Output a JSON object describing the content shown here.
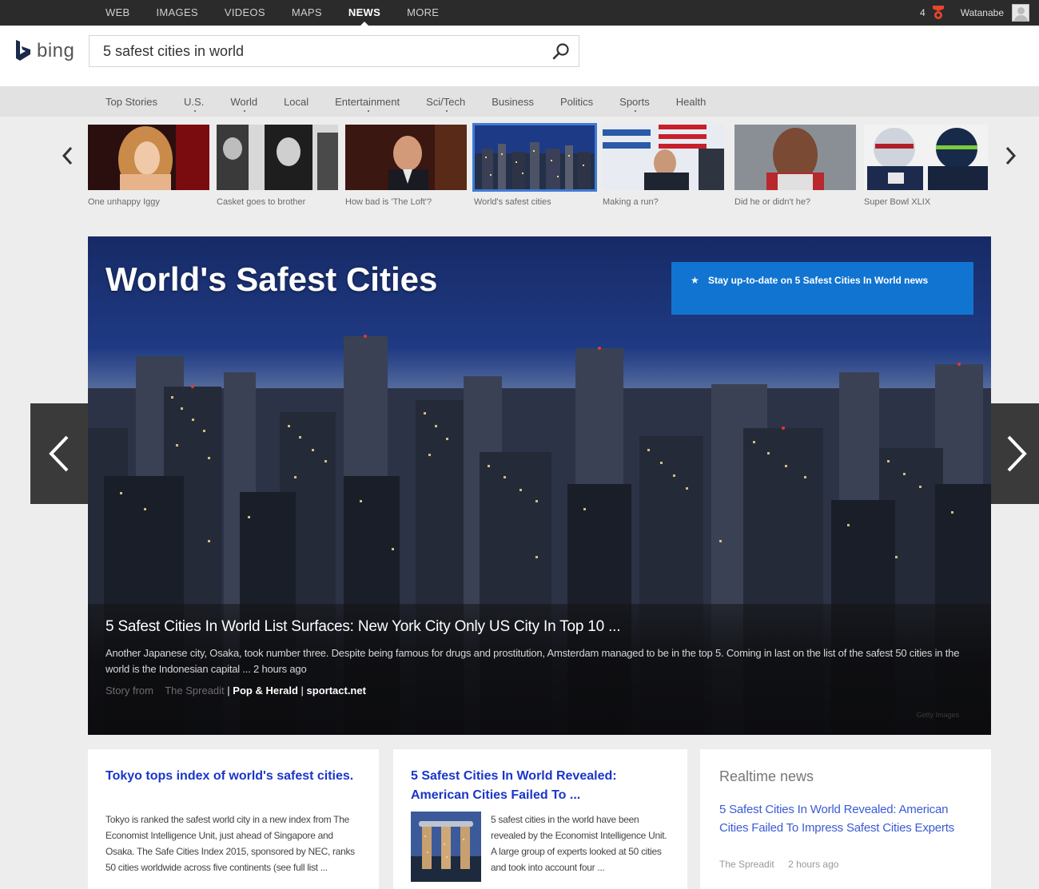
{
  "topnav": {
    "items": [
      {
        "label": "WEB"
      },
      {
        "label": "IMAGES"
      },
      {
        "label": "VIDEOS"
      },
      {
        "label": "MAPS"
      },
      {
        "label": "NEWS",
        "active": true
      },
      {
        "label": "MORE"
      }
    ],
    "reward_count": "4",
    "username": "Watanabe"
  },
  "header": {
    "logo_text": "bing",
    "search_value": "5 safest cities in world"
  },
  "categories": [
    "Top Stories",
    "U.S.",
    "World",
    "Local",
    "Entertainment",
    "Sci/Tech",
    "Business",
    "Politics",
    "Sports",
    "Health"
  ],
  "thumbs": [
    {
      "caption": "One unhappy Iggy"
    },
    {
      "caption": "Casket goes to brother"
    },
    {
      "caption": "How bad is 'The Loft'?"
    },
    {
      "caption": "World's safest cities",
      "active": true
    },
    {
      "caption": "Making a run?"
    },
    {
      "caption": "Did he or didn't he?"
    },
    {
      "caption": "Super Bowl XLIX"
    }
  ],
  "hero": {
    "title": "World's Safest Cities",
    "follow_label": "Stay up-to-date on 5 Safest Cities In World news",
    "headline": "5 Safest Cities In World List Surfaces: New York City Only US City In Top 10 ...",
    "snippet": "Another Japanese city, Osaka, took number three. Despite being famous for drugs and prostitution, Amsterdam managed to be in the top 5. Coming in last on the list of the safest 50 cities in the world is the Indonesian capital ... 2 hours ago",
    "sources_prefix": "Story from",
    "source_1": "The Spreadit",
    "source_2": "Pop & Herald",
    "source_3": "sportact.net",
    "credit": "Getty Images"
  },
  "cards": {
    "card1": {
      "title": "Tokyo tops index of world's safest cities.",
      "body": "Tokyo is ranked the safest world city in a new index from The Economist Intelligence Unit, just ahead of Singapore and Osaka. The Safe Cities Index 2015, sponsored by NEC, ranks 50 cities worldwide across five continents (see full list ..."
    },
    "card2": {
      "title": "5 Safest Cities In World Revealed: American Cities Failed To ...",
      "body": "5 safest cities in the world have been revealed by the Economist Intelligence Unit. A large group of experts looked at 50 cities and took into account four ..."
    },
    "card3": {
      "heading": "Realtime news",
      "link": "5 Safest Cities In World Revealed: American Cities Failed To Impress Safest Cities Experts",
      "source": "The Spreadit",
      "time": "2 hours ago"
    }
  },
  "colors": {
    "topbar": "#2b2b2b",
    "link_blue": "#1a35c9",
    "follow_blue": "#1174d1",
    "active_thumb": "#3f7bd6"
  }
}
